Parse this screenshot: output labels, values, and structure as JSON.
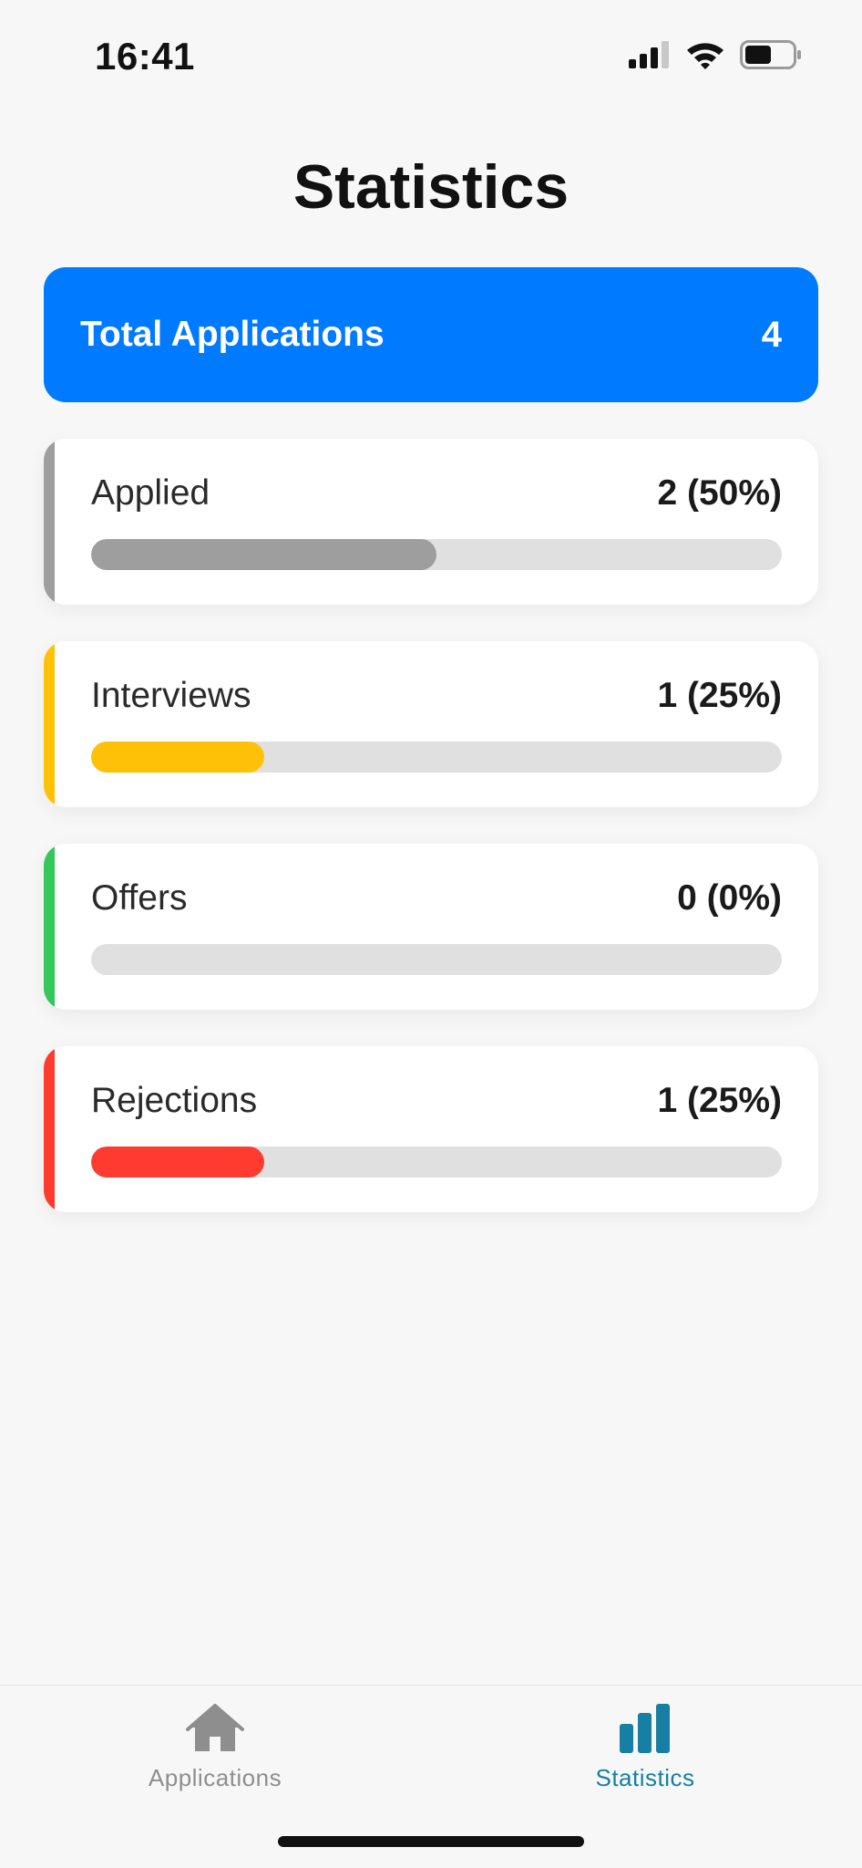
{
  "status_bar": {
    "time": "16:41",
    "icons": [
      "signal-icon",
      "wifi-icon",
      "battery-icon"
    ]
  },
  "page": {
    "title": "Statistics"
  },
  "total": {
    "label": "Total Applications",
    "value": "4",
    "color": "#007aff"
  },
  "stats": [
    {
      "label": "Applied",
      "value": "2 (50%)",
      "progress": 0.5,
      "color": "#9e9e9e"
    },
    {
      "label": "Interviews",
      "value": "1 (25%)",
      "progress": 0.25,
      "color": "#ffc107"
    },
    {
      "label": "Offers",
      "value": "0 (0%)",
      "progress": 0.0,
      "color": "#34c759"
    },
    {
      "label": "Rejections",
      "value": "1 (25%)",
      "progress": 0.25,
      "color": "#ff3b30"
    }
  ],
  "tab_bar": {
    "tabs": [
      {
        "label": "Applications",
        "icon": "home-icon",
        "active": false,
        "color": "#8e8e8e"
      },
      {
        "label": "Statistics",
        "icon": "bar-chart-icon",
        "active": true,
        "color": "#167fa3"
      }
    ]
  }
}
